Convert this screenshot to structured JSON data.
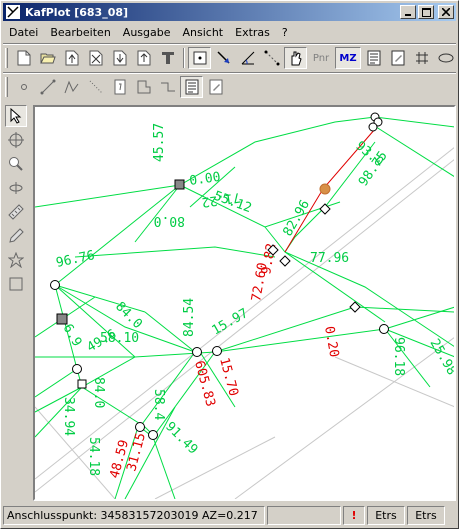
{
  "app": {
    "title": "KafPlot [683_08]"
  },
  "menu": {
    "items": [
      "Datei",
      "Bearbeiten",
      "Ausgabe",
      "Ansicht",
      "Extras",
      "?"
    ]
  },
  "toolbar1": {
    "pnr_label": "Pnr",
    "mz_label": "MZ"
  },
  "canvas": {
    "labels_green": [
      "45.57",
      "0.00",
      "71.22",
      "80.0",
      "55.12",
      "96.76",
      "93.0",
      "98.75",
      "82.96",
      "77.96",
      "6.9",
      "49.6",
      "84.54",
      "15.97",
      "58.4",
      "84.0",
      "25.98",
      "96.18",
      "34.94",
      "54.18",
      "91.49",
      "84.0",
      "58.10"
    ],
    "labels_red": [
      "9.82",
      "72.60",
      "605.83",
      "15.70",
      "0.20",
      "48.59",
      "31.15"
    ]
  },
  "status": {
    "anschluss": "Anschlusspunkt: 34583157203019   AZ=0.217",
    "warn_icon": "!",
    "etrs1": "Etrs",
    "etrs2": "Etrs"
  },
  "colors": {
    "line": "#00dd44",
    "red": "#e00000",
    "grey_line": "#c8c8c8",
    "title_start": "#0a246a",
    "title_end": "#a6caf0"
  }
}
